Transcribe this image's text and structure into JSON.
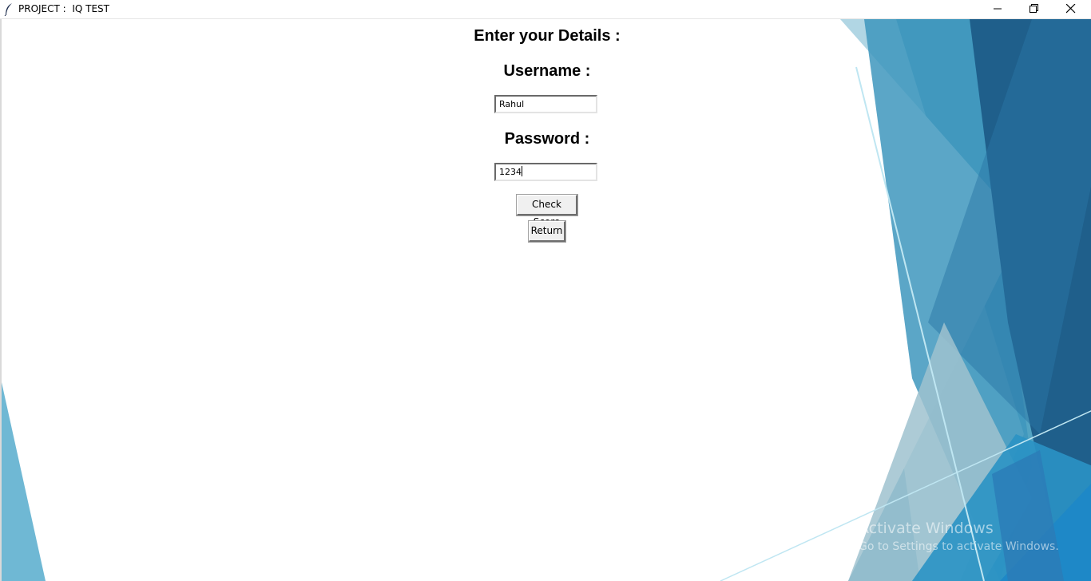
{
  "window": {
    "title": "PROJECT :  IQ TEST",
    "controls": {
      "minimize": "minimize-icon",
      "restore": "restore-icon",
      "close": "close-icon"
    }
  },
  "form": {
    "heading": "Enter your Details :",
    "username_label": "Username :",
    "username_value": "Rahul",
    "password_label": "Password :",
    "password_value": "1234",
    "check_score_button": "Check Score",
    "return_button": "Return"
  },
  "watermark": {
    "line1": "Activate Windows",
    "line2": "Go to Settings to activate Windows."
  },
  "colors": {
    "accent_dark": "#1f5f8b",
    "accent_mid": "#3a93b8",
    "accent_light": "#6fb8d4"
  }
}
